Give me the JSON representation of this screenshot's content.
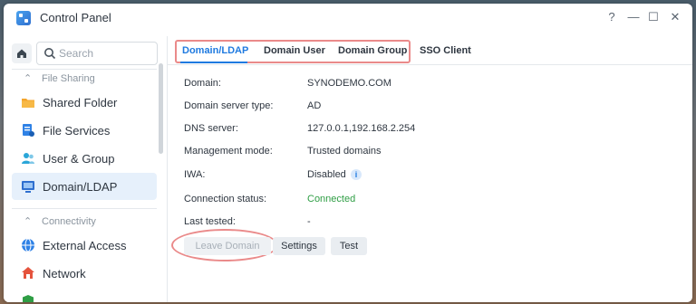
{
  "window": {
    "title": "Control Panel"
  },
  "controls": {
    "help": "?",
    "minimize": "—",
    "maximize": "☐",
    "close": "✕"
  },
  "search": {
    "placeholder": "Search"
  },
  "sidebar": {
    "sections": [
      {
        "label": "File Sharing"
      },
      {
        "label": "Connectivity"
      }
    ],
    "items": [
      {
        "label": "Shared Folder",
        "icon": "folder-icon"
      },
      {
        "label": "File Services",
        "icon": "file-services-icon"
      },
      {
        "label": "User & Group",
        "icon": "user-group-icon"
      },
      {
        "label": "Domain/LDAP",
        "icon": "domain-ldap-icon",
        "active": true
      },
      {
        "label": "External Access",
        "icon": "globe-icon"
      },
      {
        "label": "Network",
        "icon": "network-icon"
      }
    ]
  },
  "tabs": [
    {
      "label": "Domain/LDAP",
      "active": true
    },
    {
      "label": "Domain User"
    },
    {
      "label": "Domain Group"
    },
    {
      "label": "SSO Client"
    }
  ],
  "details": [
    {
      "label": "Domain:",
      "value": "SYNODEMO.COM"
    },
    {
      "label": "Domain server type:",
      "value": "AD"
    },
    {
      "label": "DNS server:",
      "value": "127.0.0.1,192.168.2.254"
    },
    {
      "label": "Management mode:",
      "value": "Trusted domains"
    },
    {
      "label": "IWA:",
      "value": "Disabled"
    },
    {
      "label": "Connection status:",
      "value": "Connected"
    },
    {
      "label": "Last tested:",
      "value": "-"
    }
  ],
  "buttons": {
    "leave_domain": "Leave Domain",
    "settings": "Settings",
    "test": "Test"
  },
  "colors": {
    "accent": "#1f7ae0",
    "connected": "#2f9e45",
    "highlight": "#ea8a8a"
  }
}
